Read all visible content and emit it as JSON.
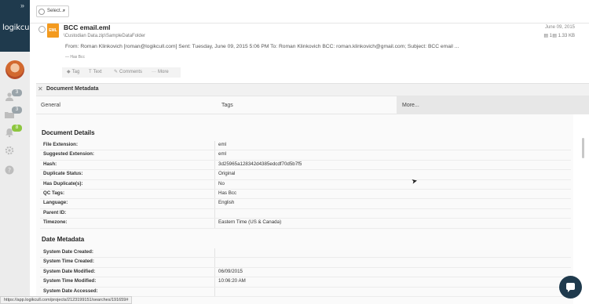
{
  "sidebar": {
    "logo": "logikcull",
    "expand_icon": "»",
    "nav": [
      {
        "name": "users-icon",
        "badge": "3",
        "badge_color": "#9aa4aa"
      },
      {
        "name": "folder-icon",
        "badge": "3",
        "badge_color": "#9aa4aa"
      },
      {
        "name": "bell-icon",
        "badge": "8",
        "badge_color": "#8dc63f"
      },
      {
        "name": "gear-icon"
      },
      {
        "name": "help-icon"
      }
    ]
  },
  "toolbar": {
    "select_label": "Select..."
  },
  "document": {
    "title": "BCC email.eml",
    "path": "\\Custodian Data.zip\\SampleDataFolder",
    "file_type": "EML",
    "date": "June 09, 2015",
    "pages": "1",
    "size": "1.33 KB",
    "summary": "From: Roman Klinkovich [roman@logikcull.com] Sent: Tuesday, June 09, 2015 5:06 PM To: Roman Klinkovich BCC: roman.klinkovich@gmail.com; Subject: BCC email ...",
    "tag": "Has Bcc",
    "actions": [
      {
        "label": "Tag",
        "icon": "tag-icon"
      },
      {
        "label": "Text",
        "icon": "text-icon"
      },
      {
        "label": "Comments",
        "icon": "comment-icon"
      },
      {
        "label": "More",
        "icon": "more-icon"
      }
    ]
  },
  "metadata_panel": {
    "title": "Document Metadata",
    "tabs": [
      "General",
      "Tags",
      "More..."
    ],
    "document_details": {
      "heading": "Document Details",
      "rows": [
        {
          "label": "File Extension:",
          "value": "eml"
        },
        {
          "label": "Suggested Extension:",
          "value": "eml"
        },
        {
          "label": "Hash:",
          "value": "3d25965a128342d4385edcdf70d5b7f5"
        },
        {
          "label": "Duplicate Status:",
          "value": "Original"
        },
        {
          "label": "Has Duplicate(s):",
          "value": "No"
        },
        {
          "label": "QC Tags:",
          "value": "Has Bcc"
        },
        {
          "label": "Language:",
          "value": "English"
        },
        {
          "label": "Parent ID:",
          "value": ""
        },
        {
          "label": "Timezone:",
          "value": "Eastern Time (US & Canada)"
        }
      ]
    },
    "date_metadata": {
      "heading": "Date Metadata",
      "rows": [
        {
          "label": "System Date Created:",
          "value": ""
        },
        {
          "label": "System Time Created:",
          "value": ""
        },
        {
          "label": "System Date Modified:",
          "value": "06/09/2015"
        },
        {
          "label": "System Time Modified:",
          "value": "10:06:20 AM"
        },
        {
          "label": "System Date Accessed:",
          "value": ""
        }
      ]
    }
  },
  "status_url": "https://app.logikcull.com/projects/2123199151/searches/191659#"
}
